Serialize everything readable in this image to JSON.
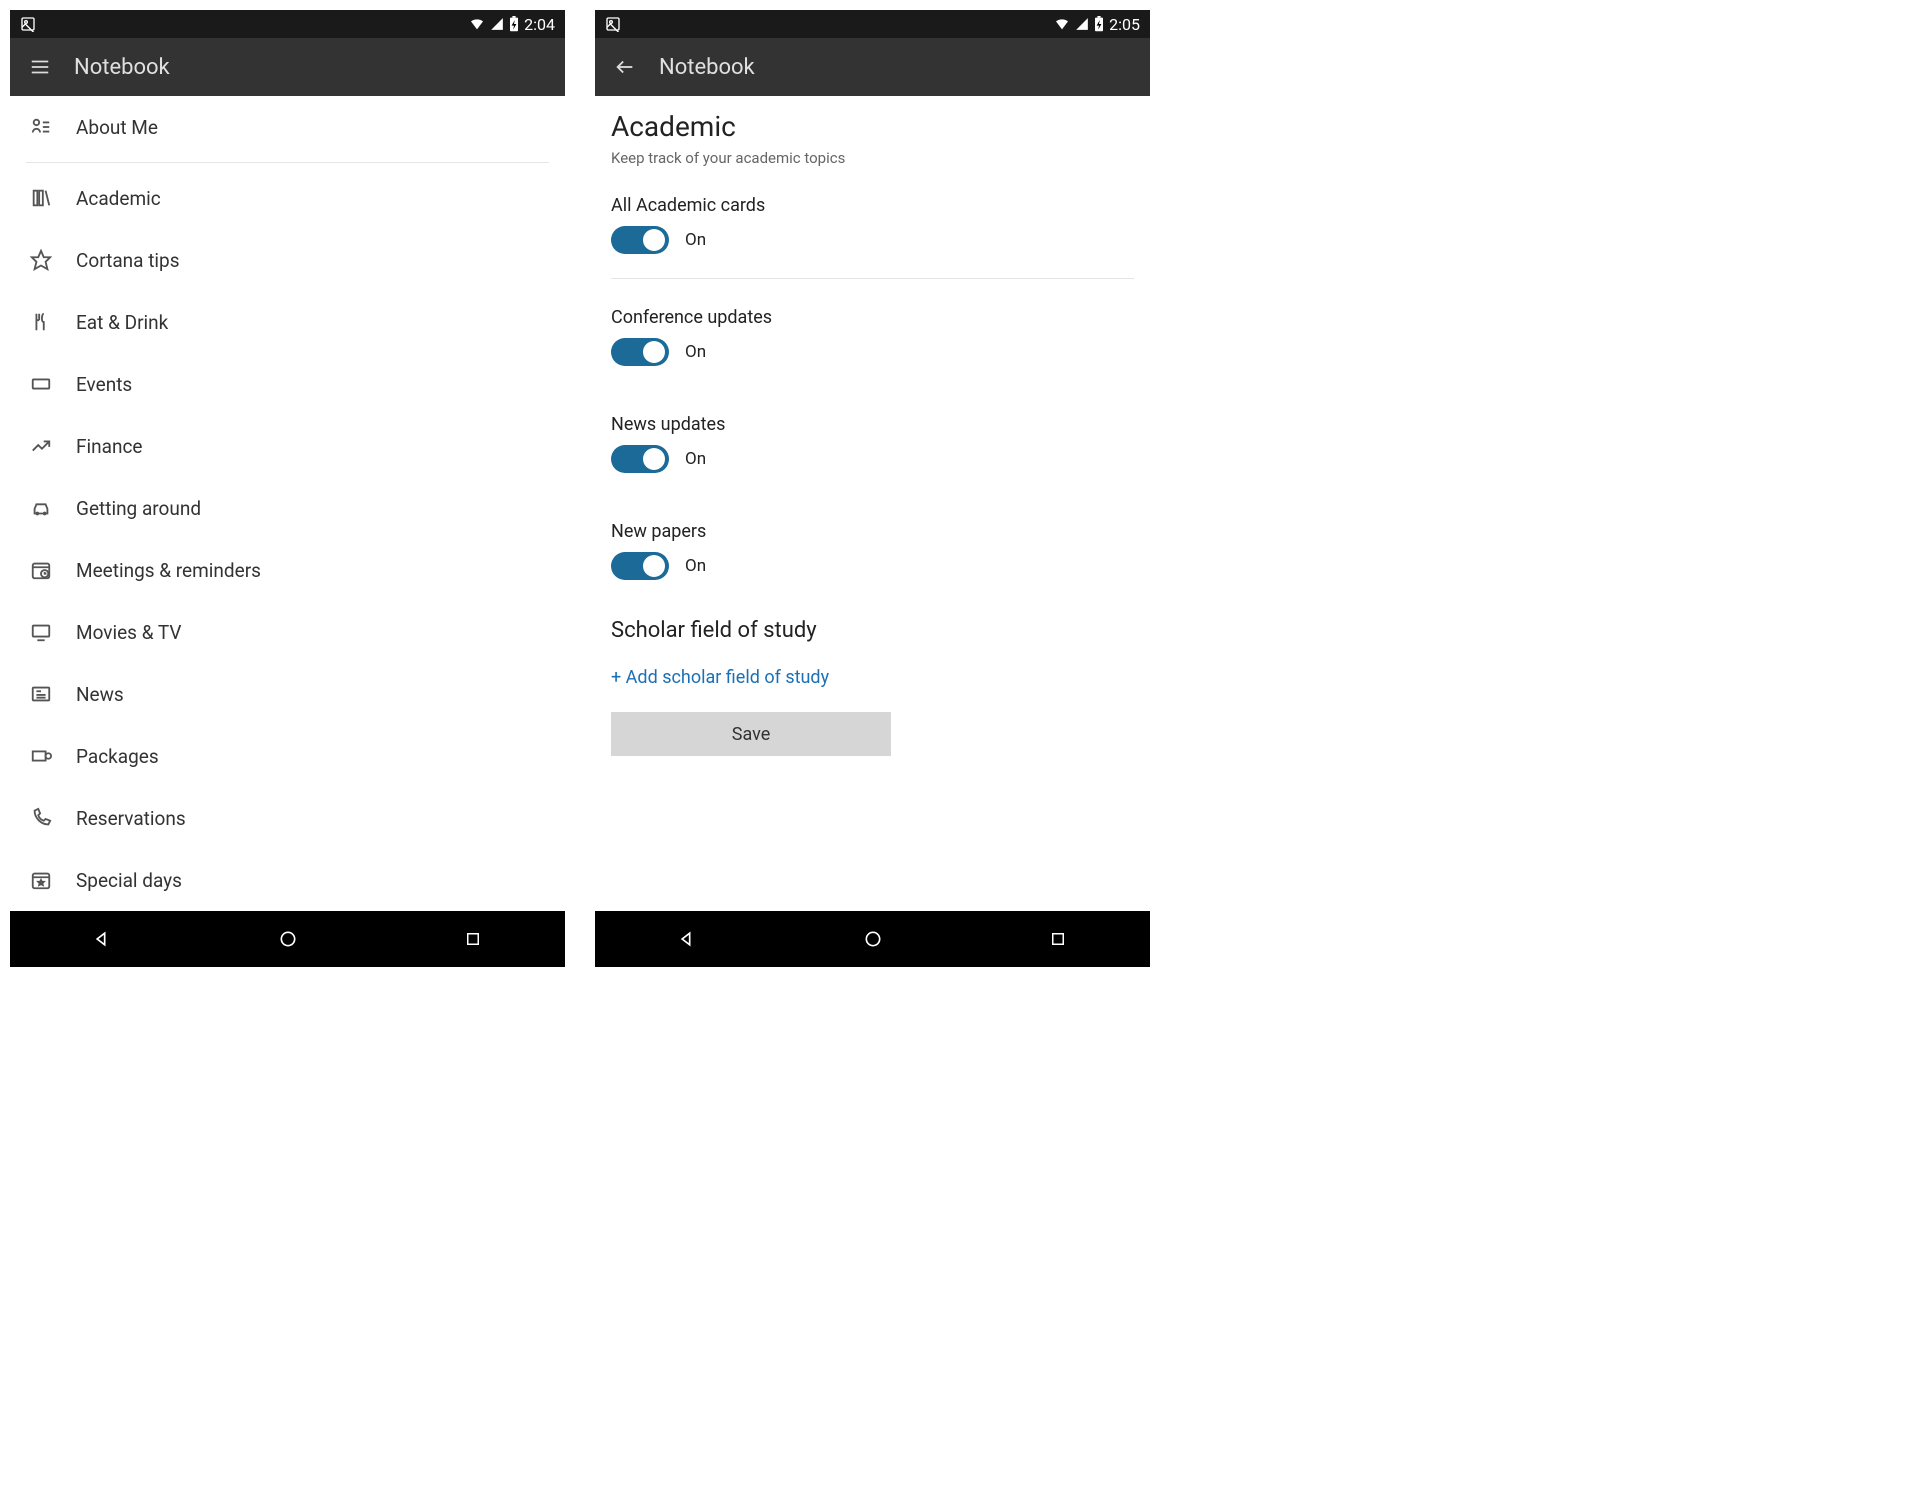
{
  "left": {
    "statusbar": {
      "time": "2:04"
    },
    "appbar": {
      "title": "Notebook"
    },
    "items": [
      {
        "label": "About Me"
      },
      {
        "label": "Academic"
      },
      {
        "label": "Cortana tips"
      },
      {
        "label": "Eat & Drink"
      },
      {
        "label": "Events"
      },
      {
        "label": "Finance"
      },
      {
        "label": "Getting around"
      },
      {
        "label": "Meetings & reminders"
      },
      {
        "label": "Movies & TV"
      },
      {
        "label": "News"
      },
      {
        "label": "Packages"
      },
      {
        "label": "Reservations"
      },
      {
        "label": "Special days"
      }
    ]
  },
  "right": {
    "statusbar": {
      "time": "2:05"
    },
    "appbar": {
      "title": "Notebook"
    },
    "title": "Academic",
    "subtitle": "Keep track of your academic topics",
    "settings": [
      {
        "label": "All Academic cards",
        "state": "On"
      },
      {
        "label": "Conference updates",
        "state": "On"
      },
      {
        "label": "News updates",
        "state": "On"
      },
      {
        "label": "New papers",
        "state": "On"
      }
    ],
    "scholar_title": "Scholar field of study",
    "add_link": "+ Add scholar field of study",
    "save_label": "Save"
  }
}
